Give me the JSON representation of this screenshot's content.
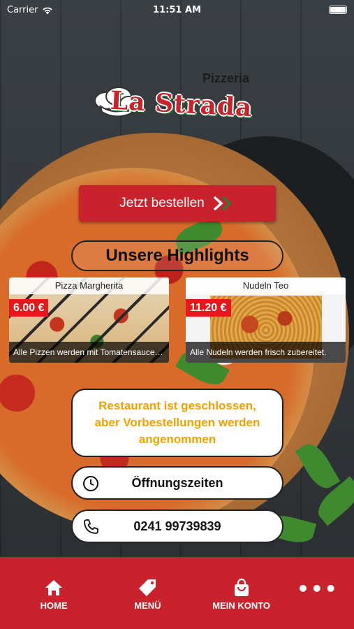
{
  "status": {
    "carrier": "Carrier",
    "time": "11:51 AM"
  },
  "logo": {
    "prefix": "Pizzeria",
    "name": "La Strada"
  },
  "order_button": {
    "label": "Jetzt bestellen"
  },
  "highlights": {
    "title": "Unsere Highlights",
    "items": [
      {
        "name": "Pizza Margherita",
        "price": "6.00 €",
        "description": "Alle Pizzen werden mit Tomatensauce u..."
      },
      {
        "name": "Nudeln Teo",
        "price": "11.20 €",
        "description": "Alle Nudeln werden frisch zubereitet."
      }
    ]
  },
  "notice": {
    "lines": [
      "Restaurant ist geschlossen,",
      "aber Vorbestellungen werden",
      "angenommen"
    ],
    "color": "#f2a200"
  },
  "info": {
    "hours_label": "Öffnungszeiten",
    "phone": "0241 99739839"
  },
  "tabbar": {
    "items": [
      {
        "label": "HOME",
        "icon": "home-icon"
      },
      {
        "label": "MENÜ",
        "icon": "tag-icon"
      },
      {
        "label": "MEIN KONTO",
        "icon": "shopping-bag-icon"
      },
      {
        "label": "",
        "icon": "more-dots-icon"
      }
    ]
  },
  "colors": {
    "brand_red": "#c8232c",
    "price_red": "#e7171b"
  }
}
